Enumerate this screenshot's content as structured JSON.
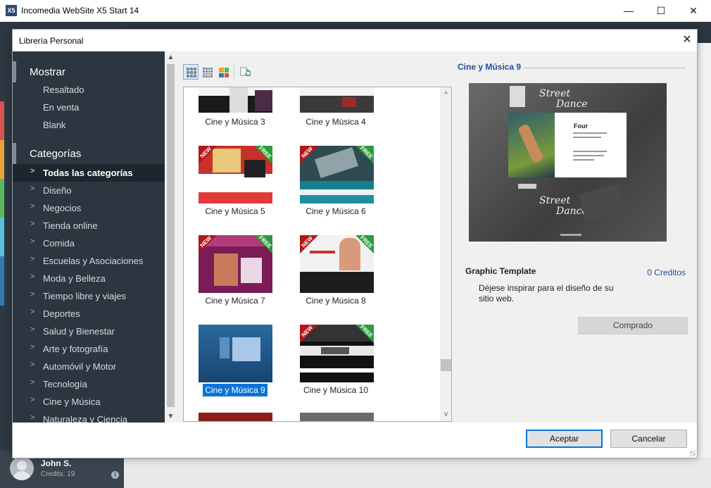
{
  "app": {
    "title": "Incomedia WebSite X5 Start 14",
    "logo_text": "X5",
    "window_controls": [
      "—",
      "☐",
      "✕"
    ],
    "user": {
      "name": "John S.",
      "credits": "Credits: 19"
    }
  },
  "dialog": {
    "title": "Librería Personal",
    "close_glyph": "✕",
    "sidebar": {
      "mostrar_header": "Mostrar",
      "mostrar_items": [
        "Resaltado",
        "En venta",
        "Blank"
      ],
      "categorias_header": "Categorías",
      "categorias_items": [
        "Todas las categorías",
        "Diseño",
        "Negocios",
        "Tienda online",
        "Comida",
        "Escuelas y Asociaciones",
        "Moda y Belleza",
        "Tiempo libre y viajes",
        "Deportes",
        "Salud y Bienestar",
        "Arte y fotografía",
        "Automóvil y Motor",
        "Tecnología",
        "Cine y Música",
        "Naturaleza y Ciencia"
      ],
      "selected_category": "Todas las categorías"
    },
    "templates": [
      {
        "label": "Cine y Música 3",
        "new": false,
        "free": false
      },
      {
        "label": "Cine y Música 4",
        "new": false,
        "free": false
      },
      {
        "label": "Cine y Música 5",
        "new": true,
        "free": true
      },
      {
        "label": "Cine y Música 6",
        "new": true,
        "free": true
      },
      {
        "label": "Cine y Música 7",
        "new": true,
        "free": true
      },
      {
        "label": "Cine y Música 8",
        "new": true,
        "free": true
      },
      {
        "label": "Cine y Música 9",
        "new": false,
        "free": false
      },
      {
        "label": "Cine y Música 10",
        "new": true,
        "free": true
      }
    ],
    "badges": {
      "new": "NEW",
      "free": "FREE"
    },
    "selected_template": "Cine y Música 9",
    "preview": {
      "title": "Cine y Música 9",
      "type": "Graphic Template",
      "credits": "0 Creditos",
      "description": "Déjese inspirar para el diseño de su sitio web.",
      "status_button": "Comprado",
      "image_text": {
        "logo_line1": "Street",
        "logo_line2": "Dance",
        "heading": "Four"
      }
    },
    "buttons": {
      "ok": "Aceptar",
      "cancel": "Cancelar"
    }
  }
}
